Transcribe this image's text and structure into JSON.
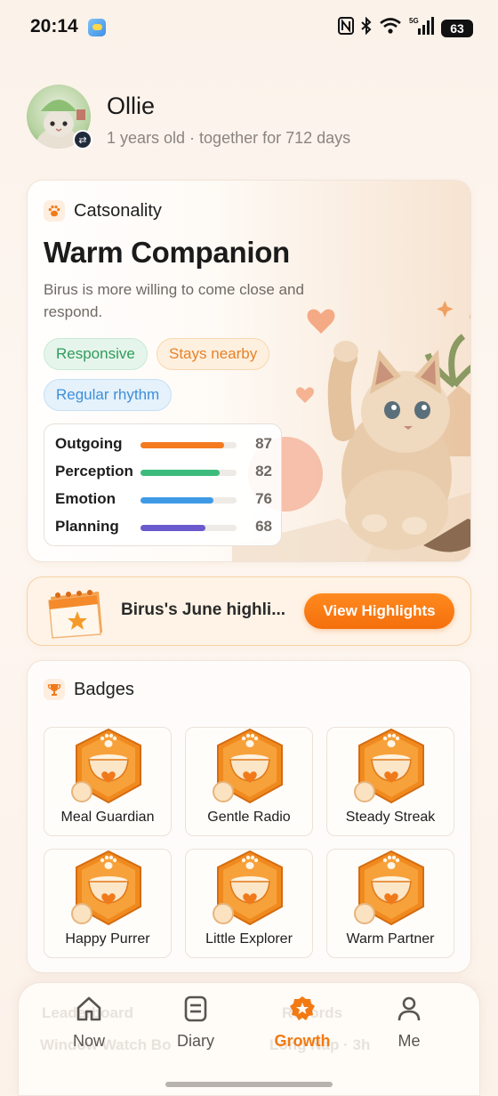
{
  "status_bar": {
    "time": "20:14",
    "battery": "63",
    "network": "5G"
  },
  "profile": {
    "name": "Ollie",
    "meta": "1 years old · together for 712 days"
  },
  "catsonality": {
    "section_title": "Catsonality",
    "headline": "Warm Companion",
    "description": "Birus is more willing to come close and respond.",
    "tags": [
      "Responsive",
      "Stays nearby",
      "Regular rhythm"
    ],
    "stats": [
      {
        "label": "Outgoing",
        "value": 87,
        "color": "#f47a1f"
      },
      {
        "label": "Perception",
        "value": 82,
        "color": "#3dbb7c"
      },
      {
        "label": "Emotion",
        "value": 76,
        "color": "#3f9ae6"
      },
      {
        "label": "Planning",
        "value": 68,
        "color": "#6a5acd"
      }
    ]
  },
  "highlight": {
    "text": "Birus's June highli...",
    "button": "View Highlights"
  },
  "badges": {
    "section_title": "Badges",
    "items": [
      "Meal Guardian",
      "Gentle Radio",
      "Steady Streak",
      "Happy Purrer",
      "Little Explorer",
      "Warm Partner"
    ]
  },
  "behind_nav": {
    "left_title": "Leaderboard",
    "left_sub": "Window Watch Bo",
    "right_title": "Records",
    "right_sub": "Long Nap · 3h"
  },
  "nav": {
    "items": [
      "Now",
      "Diary",
      "Growth",
      "Me"
    ],
    "active": "Growth"
  },
  "colors": {
    "accent": "#f27a12",
    "badge_orange": "#f59a2a"
  }
}
